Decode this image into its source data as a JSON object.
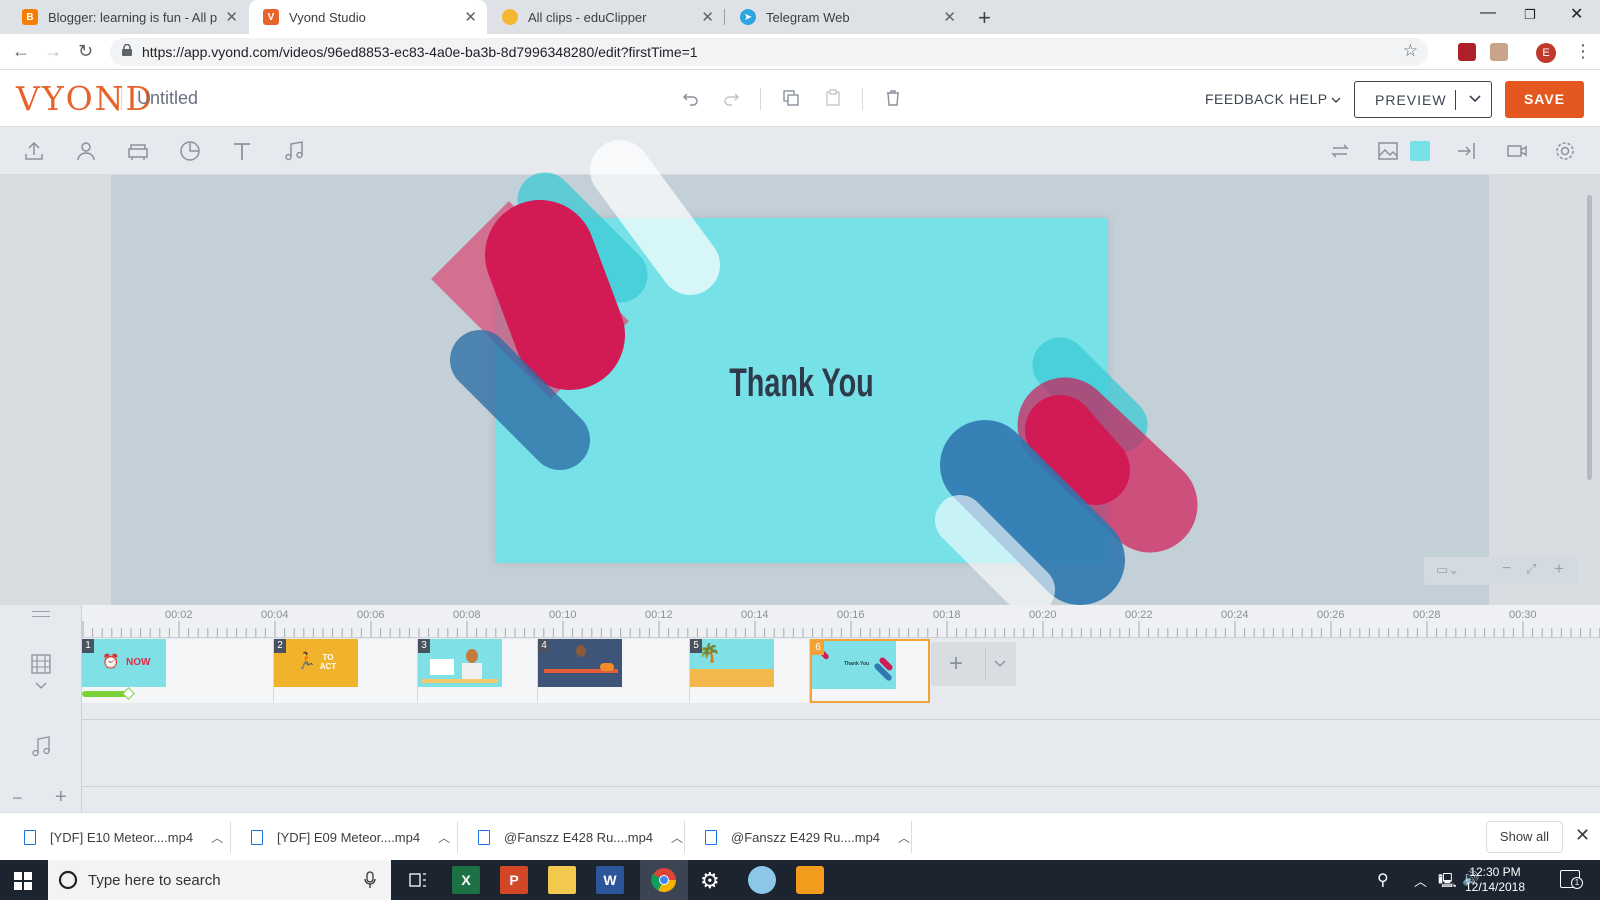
{
  "browser": {
    "tabs": [
      {
        "title": "Blogger: learning is fun - All post",
        "favicon_color": "#f57d00",
        "active": false
      },
      {
        "title": "Vyond Studio",
        "favicon_color": "#e8632b",
        "active": true
      },
      {
        "title": "All clips - eduClipper",
        "favicon_color": "#f5b731",
        "active": false
      },
      {
        "title": "Telegram Web",
        "favicon_color": "#2ca5e0",
        "active": false
      }
    ],
    "url": "https://app.vyond.com/videos/96ed8853-ec83-4a0e-ba3b-8d7996348280/edit?firstTime=1",
    "profile_initial": "E"
  },
  "app": {
    "logo": "VYOND",
    "doc_title": "Untitled",
    "feedback": "FEEDBACK",
    "help": "HELP",
    "preview": "PREVIEW",
    "save": "SAVE",
    "accent": "#e4571f"
  },
  "scene": {
    "text": "Thank You",
    "background_color": "#77e1e8"
  },
  "timeline": {
    "ticks": [
      "00:02",
      "00:04",
      "00:06",
      "00:08",
      "00:10",
      "00:12",
      "00:14",
      "00:16",
      "00:18",
      "00:20",
      "00:22",
      "00:24",
      "00:26",
      "00:28",
      "00:30"
    ],
    "scenes": [
      {
        "num": "1",
        "thumb_color": "#7fe0e6",
        "caption": "NOW"
      },
      {
        "num": "2",
        "thumb_color": "#f2b32c",
        "caption": "TO ACT"
      },
      {
        "num": "3",
        "thumb_color": "#7fe0e6",
        "caption": ""
      },
      {
        "num": "4",
        "thumb_color": "#3e5478",
        "caption": ""
      },
      {
        "num": "5",
        "thumb_color": "#7fe0e6",
        "caption": ""
      },
      {
        "num": "6",
        "thumb_color": "#7fe0e6",
        "caption": "Thank You"
      }
    ]
  },
  "downloads": [
    {
      "name": "[YDF] E10 Meteor....mp4"
    },
    {
      "name": "[YDF] E09 Meteor....mp4"
    },
    {
      "name": "@Fanszz E428 Ru....mp4"
    },
    {
      "name": "@Fanszz E429 Ru....mp4"
    }
  ],
  "show_all": "Show all",
  "taskbar": {
    "search_placeholder": "Type here to search",
    "time": "12:30 PM",
    "date": "12/14/2018",
    "notification_count": "1"
  }
}
